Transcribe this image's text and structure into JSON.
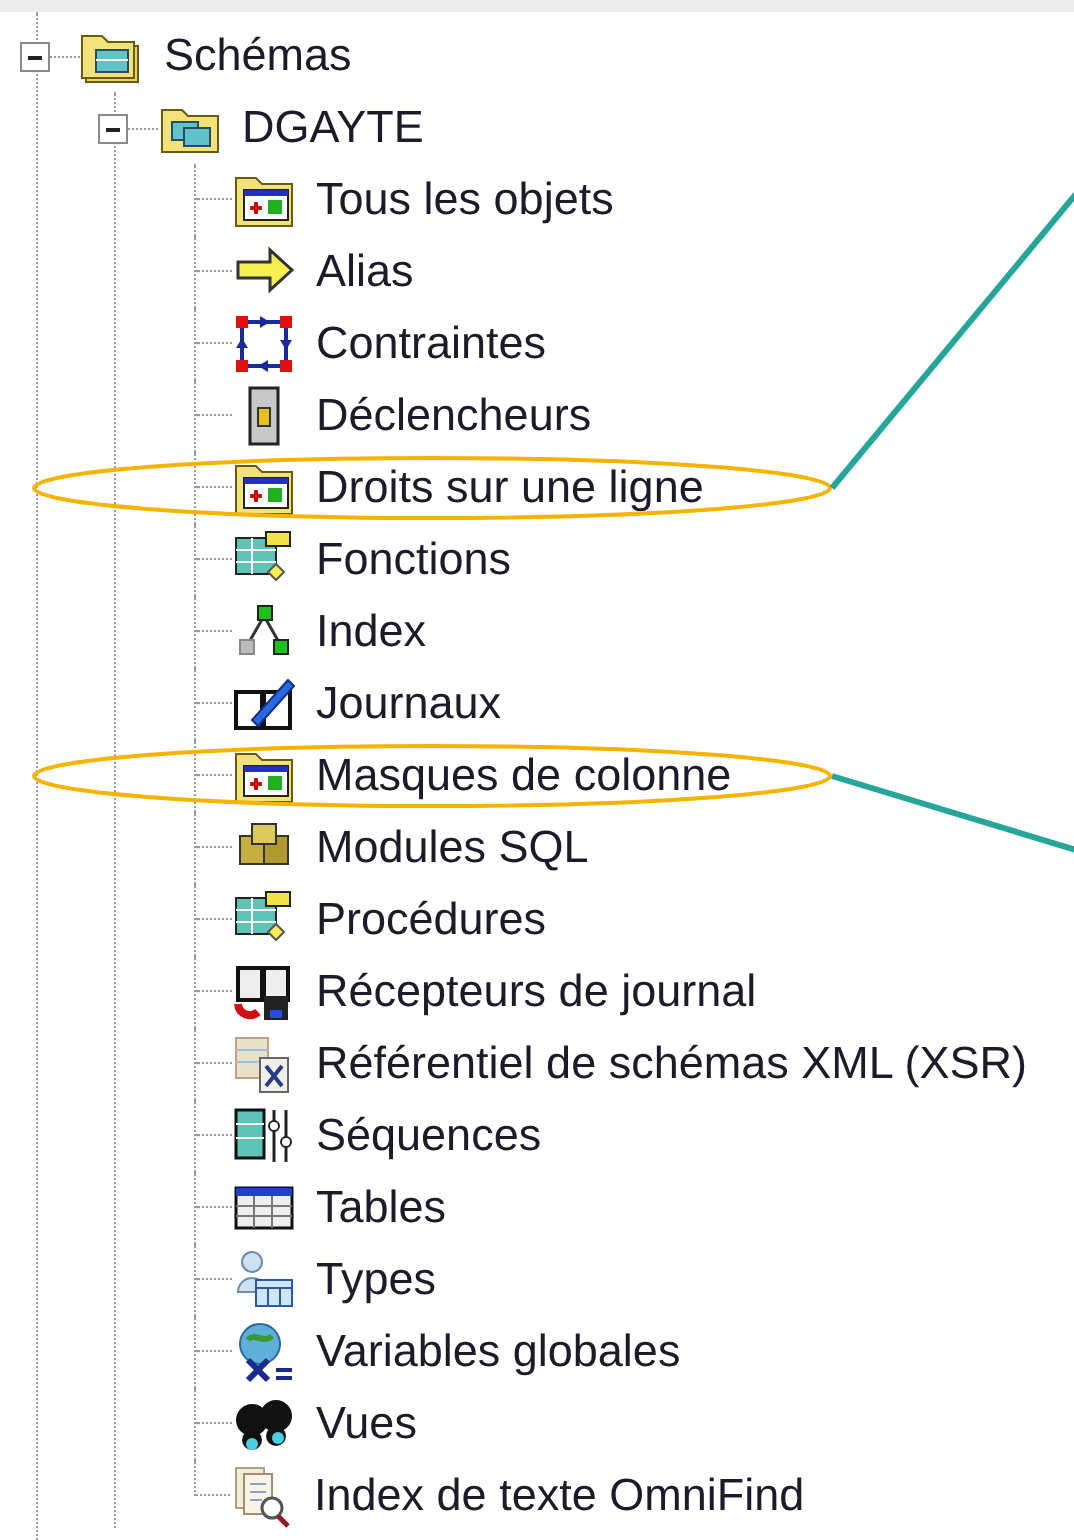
{
  "tree": [
    {
      "label": "Schémas",
      "kind": "schemas",
      "expanded": true,
      "children": [
        {
          "label": "DGAYTE",
          "kind": "schema",
          "expanded": true,
          "children": [
            {
              "label": "Tous les objets",
              "kind": "objects",
              "circled": false
            },
            {
              "label": "Alias",
              "kind": "alias",
              "circled": false
            },
            {
              "label": "Contraintes",
              "kind": "constraint",
              "circled": false
            },
            {
              "label": "Déclencheurs",
              "kind": "trigger",
              "circled": false
            },
            {
              "label": "Droits sur une ligne",
              "kind": "objects",
              "circled": true,
              "leader_rises": true
            },
            {
              "label": "Fonctions",
              "kind": "function",
              "circled": false
            },
            {
              "label": "Index",
              "kind": "index",
              "circled": false
            },
            {
              "label": "Journaux",
              "kind": "journal",
              "circled": false
            },
            {
              "label": "Masques de colonne",
              "kind": "objects",
              "circled": true,
              "leader_rises": false
            },
            {
              "label": "Modules SQL",
              "kind": "module",
              "circled": false
            },
            {
              "label": "Procédures",
              "kind": "function",
              "circled": false
            },
            {
              "label": "Récepteurs de journal",
              "kind": "receiver",
              "circled": false
            },
            {
              "label": "Référentiel de schémas XML (XSR)",
              "kind": "xsr",
              "circled": false
            },
            {
              "label": "Séquences",
              "kind": "sequence",
              "circled": false
            },
            {
              "label": "Tables",
              "kind": "table",
              "circled": false
            },
            {
              "label": "Types",
              "kind": "type",
              "circled": false
            },
            {
              "label": "Variables globales",
              "kind": "variable",
              "circled": false
            },
            {
              "label": "Vues",
              "kind": "view",
              "circled": false
            },
            {
              "label": "Index de texte OmniFind",
              "kind": "fulltext",
              "circled": false
            }
          ]
        }
      ]
    }
  ]
}
